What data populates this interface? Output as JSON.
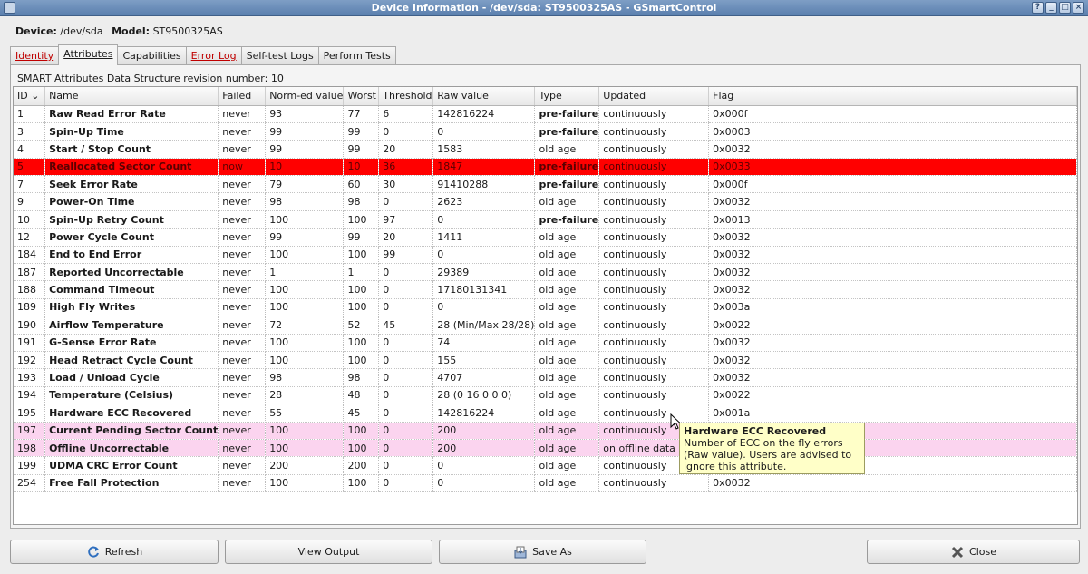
{
  "window": {
    "title": "Device Information - /dev/sda: ST9500325AS - GSmartControl"
  },
  "device": {
    "device_label": "Device:",
    "device_value": "/dev/sda",
    "model_label": "Model:",
    "model_value": "ST9500325AS"
  },
  "tabs": [
    {
      "label": "Identity"
    },
    {
      "label": "Attributes"
    },
    {
      "label": "Capabilities"
    },
    {
      "label": "Error Log"
    },
    {
      "label": "Self-test Logs"
    },
    {
      "label": "Perform Tests"
    }
  ],
  "attributes": {
    "revision_text": "SMART Attributes Data Structure revision number: 10",
    "columns": [
      "ID",
      "Name",
      "Failed",
      "Norm-ed value",
      "Worst",
      "Threshold",
      "Raw value",
      "Type",
      "Updated",
      "Flag"
    ],
    "sort_indicator": "⌄",
    "rows": [
      [
        "1",
        "Raw Read Error Rate",
        "never",
        "93",
        "77",
        "6",
        "142816224",
        "pre-failure",
        "continuously",
        "0x000f"
      ],
      [
        "3",
        "Spin-Up Time",
        "never",
        "99",
        "99",
        "0",
        "0",
        "pre-failure",
        "continuously",
        "0x0003"
      ],
      [
        "4",
        "Start / Stop Count",
        "never",
        "99",
        "99",
        "20",
        "1583",
        "old age",
        "continuously",
        "0x0032"
      ],
      [
        "5",
        "Reallocated Sector Count",
        "now",
        "10",
        "10",
        "36",
        "1847",
        "pre-failure",
        "continuously",
        "0x0033"
      ],
      [
        "7",
        "Seek Error Rate",
        "never",
        "79",
        "60",
        "30",
        "91410288",
        "pre-failure",
        "continuously",
        "0x000f"
      ],
      [
        "9",
        "Power-On Time",
        "never",
        "98",
        "98",
        "0",
        "2623",
        "old age",
        "continuously",
        "0x0032"
      ],
      [
        "10",
        "Spin-Up Retry Count",
        "never",
        "100",
        "100",
        "97",
        "0",
        "pre-failure",
        "continuously",
        "0x0013"
      ],
      [
        "12",
        "Power Cycle Count",
        "never",
        "99",
        "99",
        "20",
        "1411",
        "old age",
        "continuously",
        "0x0032"
      ],
      [
        "184",
        "End to End Error",
        "never",
        "100",
        "100",
        "99",
        "0",
        "old age",
        "continuously",
        "0x0032"
      ],
      [
        "187",
        "Reported Uncorrectable",
        "never",
        "1",
        "1",
        "0",
        "29389",
        "old age",
        "continuously",
        "0x0032"
      ],
      [
        "188",
        "Command Timeout",
        "never",
        "100",
        "100",
        "0",
        "17180131341",
        "old age",
        "continuously",
        "0x0032"
      ],
      [
        "189",
        "High Fly Writes",
        "never",
        "100",
        "100",
        "0",
        "0",
        "old age",
        "continuously",
        "0x003a"
      ],
      [
        "190",
        "Airflow Temperature",
        "never",
        "72",
        "52",
        "45",
        "28 (Min/Max 28/28)",
        "old age",
        "continuously",
        "0x0022"
      ],
      [
        "191",
        "G-Sense Error Rate",
        "never",
        "100",
        "100",
        "0",
        "74",
        "old age",
        "continuously",
        "0x0032"
      ],
      [
        "192",
        "Head Retract Cycle Count",
        "never",
        "100",
        "100",
        "0",
        "155",
        "old age",
        "continuously",
        "0x0032"
      ],
      [
        "193",
        "Load / Unload Cycle",
        "never",
        "98",
        "98",
        "0",
        "4707",
        "old age",
        "continuously",
        "0x0032"
      ],
      [
        "194",
        "Temperature (Celsius)",
        "never",
        "28",
        "48",
        "0",
        "28 (0 16 0 0 0)",
        "old age",
        "continuously",
        "0x0022"
      ],
      [
        "195",
        "Hardware ECC Recovered",
        "never",
        "55",
        "45",
        "0",
        "142816224",
        "old age",
        "continuously",
        "0x001a"
      ],
      [
        "197",
        "Current Pending Sector Count",
        "never",
        "100",
        "100",
        "0",
        "200",
        "old age",
        "continuously",
        ""
      ],
      [
        "198",
        "Offline Uncorrectable",
        "never",
        "100",
        "100",
        "0",
        "200",
        "old age",
        "on offline data collec",
        ""
      ],
      [
        "199",
        "UDMA CRC Error Count",
        "never",
        "200",
        "200",
        "0",
        "0",
        "old age",
        "continuously",
        ""
      ],
      [
        "254",
        "Free Fall Protection",
        "never",
        "100",
        "100",
        "0",
        "0",
        "old age",
        "continuously",
        "0x0032"
      ]
    ],
    "row_states": [
      "normal",
      "normal",
      "normal",
      "failed",
      "normal",
      "normal",
      "normal",
      "normal",
      "normal",
      "normal",
      "normal",
      "normal",
      "normal",
      "normal",
      "normal",
      "normal",
      "normal",
      "normal",
      "warn",
      "warn",
      "normal",
      "normal"
    ]
  },
  "tooltip": {
    "title": "Hardware ECC Recovered",
    "body": "Number of ECC on the fly errors (Raw value). Users are advised to ignore this attribute."
  },
  "buttons": {
    "refresh": "Refresh",
    "view_output": "View Output",
    "save_as": "Save As",
    "close": "Close"
  },
  "colors": {
    "failed_row": "#ff0000",
    "warning_row": "#fbd4ef",
    "tooltip_bg": "#ffffc8",
    "titlebar": "#5a7fae"
  }
}
